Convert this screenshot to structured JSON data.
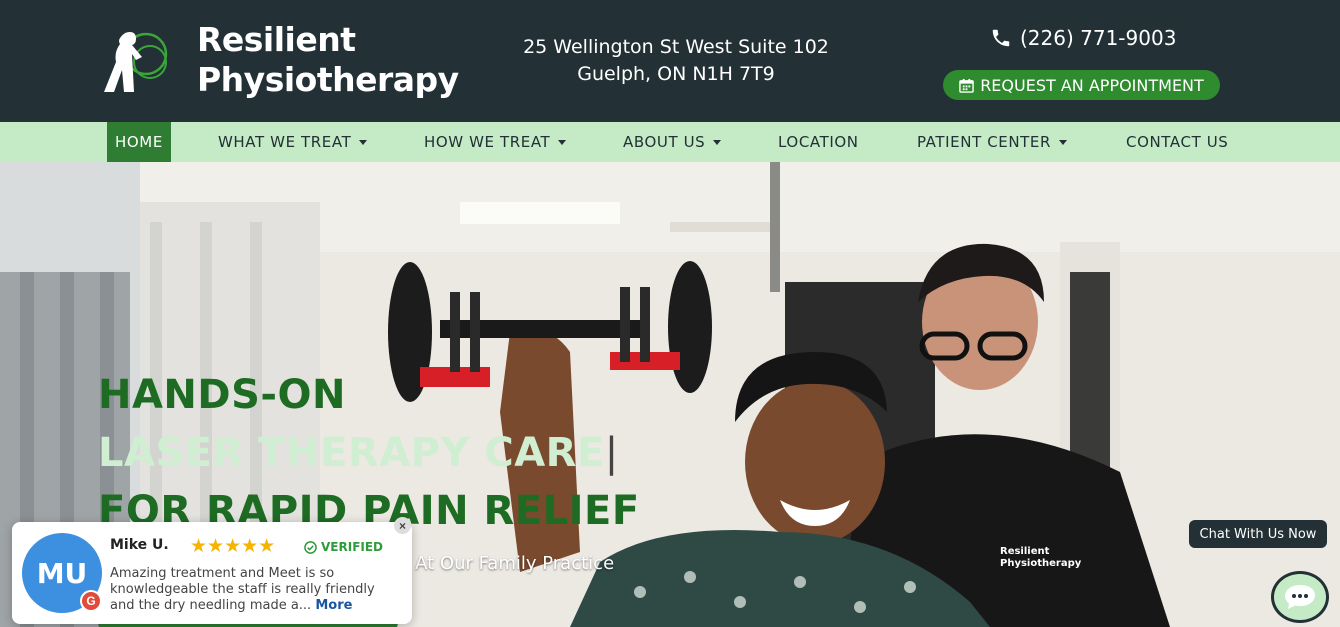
{
  "header": {
    "brand_line1": "Resilient",
    "brand_line2": "Physiotherapy",
    "address_line1": "25 Wellington St West Suite 102",
    "address_line2": "Guelph, ON N1H 7T9",
    "phone": "(226) 771-9003",
    "appointment_label": "REQUEST AN APPOINTMENT",
    "phone_icon": "phone-icon",
    "calendar_icon": "calendar-icon"
  },
  "nav": {
    "items": [
      {
        "label": "HOME",
        "active": true,
        "dropdown": false
      },
      {
        "label": "WHAT WE TREAT",
        "active": false,
        "dropdown": true
      },
      {
        "label": "HOW WE TREAT",
        "active": false,
        "dropdown": true
      },
      {
        "label": "ABOUT US",
        "active": false,
        "dropdown": true
      },
      {
        "label": "LOCATION",
        "active": false,
        "dropdown": false
      },
      {
        "label": "PATIENT CENTER",
        "active": false,
        "dropdown": true
      },
      {
        "label": "CONTACT US",
        "active": false,
        "dropdown": false
      }
    ]
  },
  "hero": {
    "line1": "HANDS-ON",
    "line2": "LASER THERAPY CARE",
    "line3": "FOR RAPID PAIN RELIEF",
    "subtitle": "n At Our Family Practice"
  },
  "review": {
    "initials": "MU",
    "name": "Mike U.",
    "stars": 5,
    "verified": "VERIFIED",
    "text": "Amazing treatment and Meet is so knowledgeable the staff is really friendly and the dry needling made a...",
    "more": "More",
    "close": "×",
    "source_badge": "G"
  },
  "chat": {
    "label": "Chat With Us Now"
  },
  "colors": {
    "header_bg": "#233035",
    "nav_bg": "#c4ebc6",
    "accent_green": "#2e7d32",
    "button_green": "#2e8b2e",
    "hero_light_green": "#cfeed2"
  }
}
